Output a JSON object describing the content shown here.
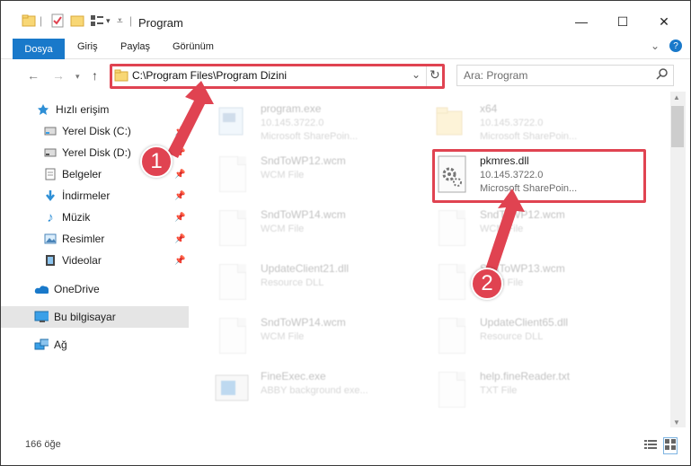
{
  "window": {
    "title": "Program",
    "minimize": "—",
    "maximize": "☐",
    "close": "✕"
  },
  "ribbon": {
    "tabs": [
      "Dosya",
      "Giriş",
      "Paylaş",
      "Görünüm"
    ],
    "expand": "⌄",
    "help": "?"
  },
  "address": {
    "path": "C:\\Program Files\\Program Dizini",
    "refresh": "↻",
    "dropdown": "⌄"
  },
  "search": {
    "placeholder": "Ara: Program"
  },
  "sidebar": {
    "items": [
      {
        "label": "Hızlı erişim",
        "icon": "star-icon"
      },
      {
        "label": "Yerel Disk (C:)",
        "icon": "drive-icon"
      },
      {
        "label": "Yerel Disk (D:)",
        "icon": "drive-icon"
      },
      {
        "label": "Belgeler",
        "icon": "documents-icon"
      },
      {
        "label": "İndirmeler",
        "icon": "download-icon"
      },
      {
        "label": "Müzik",
        "icon": "music-icon"
      },
      {
        "label": "Resimler",
        "icon": "pictures-icon"
      },
      {
        "label": "Videolar",
        "icon": "videos-icon"
      },
      {
        "label": "OneDrive",
        "icon": "cloud-icon"
      },
      {
        "label": "Bu bilgisayar",
        "icon": "computer-icon"
      },
      {
        "label": "Ağ",
        "icon": "network-icon"
      }
    ]
  },
  "files": [
    {
      "name": "program.exe",
      "line1": "10.145.3722.0",
      "line2": "Microsoft SharePoin..."
    },
    {
      "name": "x64",
      "line1": "10.145.3722.0",
      "line2": "Microsoft SharePoin..."
    },
    {
      "name": "SndToWP12.wcm",
      "line1": "WCM File",
      "line2": ""
    },
    {
      "name": "pkmres.dll",
      "line1": "10.145.3722.0",
      "line2": "Microsoft SharePoin..."
    },
    {
      "name": "SndToWP14.wcm",
      "line1": "WCM File",
      "line2": ""
    },
    {
      "name": "SndToWP12.wcm",
      "line1": "WCM File",
      "line2": ""
    },
    {
      "name": "UpdateClient21.dll",
      "line1": "Resource DLL",
      "line2": ""
    },
    {
      "name": "SndToWP13.wcm",
      "line1": "WCM File",
      "line2": ""
    },
    {
      "name": "SndToWP14.wcm",
      "line1": "WCM File",
      "line2": ""
    },
    {
      "name": "UpdateClient65.dll",
      "line1": "Resource DLL",
      "line2": ""
    },
    {
      "name": "FineExec.exe",
      "line1": "ABBY background exe...",
      "line2": ""
    },
    {
      "name": "help.fineReader.txt",
      "line1": "TXT File",
      "line2": ""
    }
  ],
  "status": {
    "count": "166 öğe"
  },
  "annotations": {
    "step1": "1",
    "step2": "2"
  },
  "colors": {
    "accent": "#1979ca",
    "highlight": "#e04351",
    "selected": "#e5e5e5"
  }
}
